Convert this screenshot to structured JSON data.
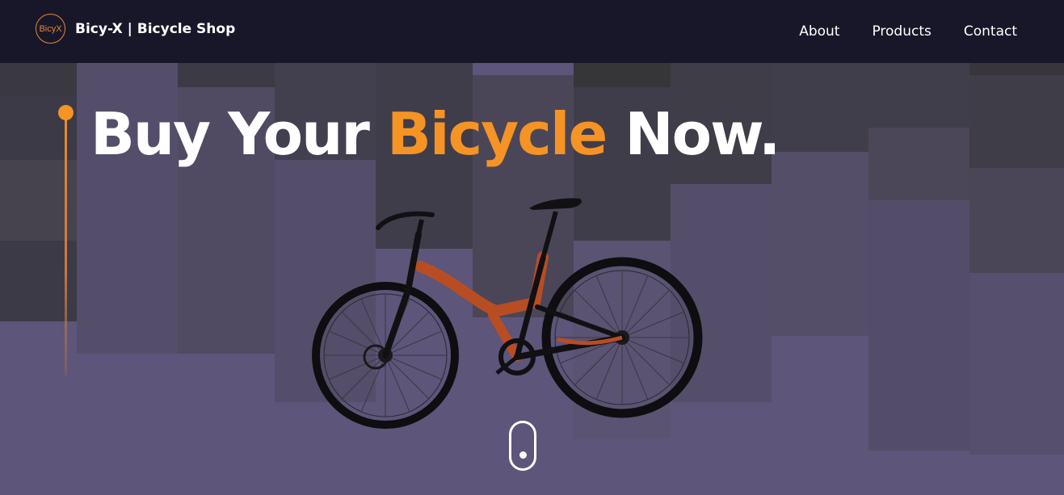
{
  "header": {
    "logo_text": "BicyX",
    "brand": "Bicy-X  | Bicycle Shop",
    "nav": [
      "About",
      "Products",
      "Contact"
    ]
  },
  "hero": {
    "headline_part1": "Buy Your ",
    "headline_highlight": "Bicycle",
    "headline_part2": " Now."
  },
  "colors": {
    "header_bg": "#18172a",
    "hero_bg": "#5d557a",
    "accent": "#f59325",
    "text": "#ffffff"
  },
  "icons": [
    "logo-icon",
    "bicycle-image",
    "scroll-mouse-icon"
  ]
}
